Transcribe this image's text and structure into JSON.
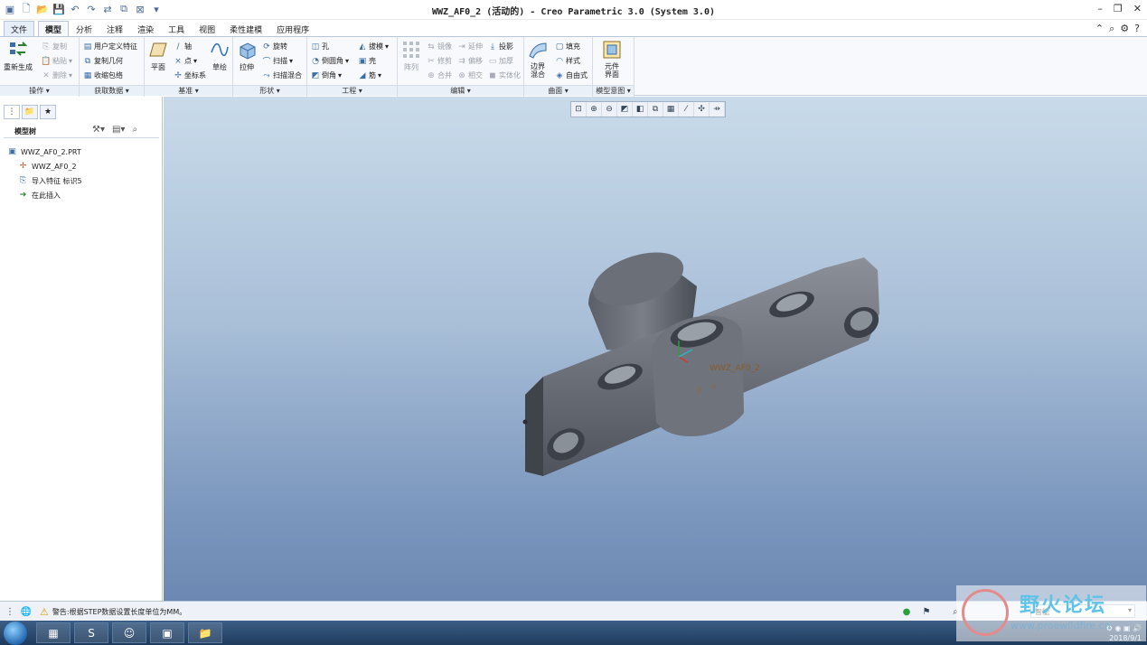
{
  "window": {
    "title": "WWZ_AF0_2 (活动的) - Creo Parametric 3.0 (System 3.0)"
  },
  "tabs": [
    "文件",
    "模型",
    "分析",
    "注释",
    "渲染",
    "工具",
    "视图",
    "柔性建模",
    "应用程序"
  ],
  "active_tab": "模型",
  "ribbon": {
    "groups": {
      "ops": {
        "label": "操作",
        "regen": "重新生成",
        "copy": "复制",
        "paste": "粘贴",
        "delete": "删除"
      },
      "getdata": {
        "label": "获取数据",
        "udf": "用户定义特征",
        "copygeom": "复制几何",
        "shrinkwrap": "收缩包络"
      },
      "datum": {
        "label": "基准",
        "plane": "平面",
        "axis": "轴",
        "point": "点",
        "csys": "坐标系",
        "sketch": "草绘"
      },
      "shapes": {
        "label": "形状",
        "extrude": "拉伸",
        "revolve": "旋转",
        "sweep": "扫描",
        "sweptblend": "扫描混合"
      },
      "engineering": {
        "label": "工程",
        "hole": "孔",
        "round": "倒圆角",
        "chamfer": "倒角",
        "draft": "拔模",
        "shell": "壳",
        "rib": "筋"
      },
      "editing": {
        "label": "编辑",
        "pattern": "阵列",
        "mirror": "镜像",
        "extend": "延伸",
        "project": "投影",
        "trim": "修剪",
        "offset": "偏移",
        "thicken": "加厚",
        "merge": "合并",
        "intersect": "相交",
        "solidify": "实体化"
      },
      "surfaces": {
        "label": "曲面",
        "boundary": "边界混合",
        "fill": "填充",
        "style": "样式",
        "freestyle": "自由式"
      },
      "intent": {
        "label": "模型意图",
        "component": "元件界面"
      }
    }
  },
  "model_tree": {
    "title": "模型树",
    "items": [
      "WWZ_AF0_2.PRT",
      "WWZ_AF0_2",
      "导入特征 标识5",
      "在此插入"
    ]
  },
  "viewport": {
    "csys_label": "WWZ_AF0_2",
    "axis_y": "y",
    "axis_x": "x"
  },
  "status": {
    "message": "警告:根据STEP数据设置长度单位为MM。",
    "filter": "智能"
  },
  "taskbar": {
    "date": "2018/9/1"
  },
  "watermark": {
    "text": "野火论坛",
    "url": "www.proewildfire.cn"
  }
}
